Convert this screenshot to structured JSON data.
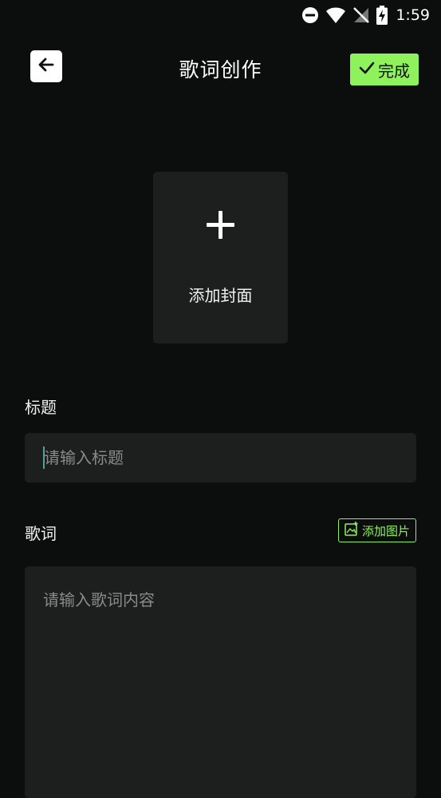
{
  "status_bar": {
    "time": "1:59",
    "icons": [
      "do-not-disturb-icon",
      "wifi-icon",
      "no-signal-icon",
      "battery-charging-icon"
    ]
  },
  "header": {
    "back_icon": "arrow-left-icon",
    "title": "歌词创作",
    "done_label": "完成",
    "done_icon": "checkmark-icon",
    "accent_color": "#8ef25c"
  },
  "cover": {
    "icon": "plus-icon",
    "label": "添加封面"
  },
  "title_section": {
    "label": "标题",
    "placeholder": "请输入标题",
    "value": ""
  },
  "lyrics_section": {
    "label": "歌词",
    "add_image_label": "添加图片",
    "add_image_icon": "add-image-icon",
    "placeholder": "请输入歌词内容",
    "value": ""
  }
}
